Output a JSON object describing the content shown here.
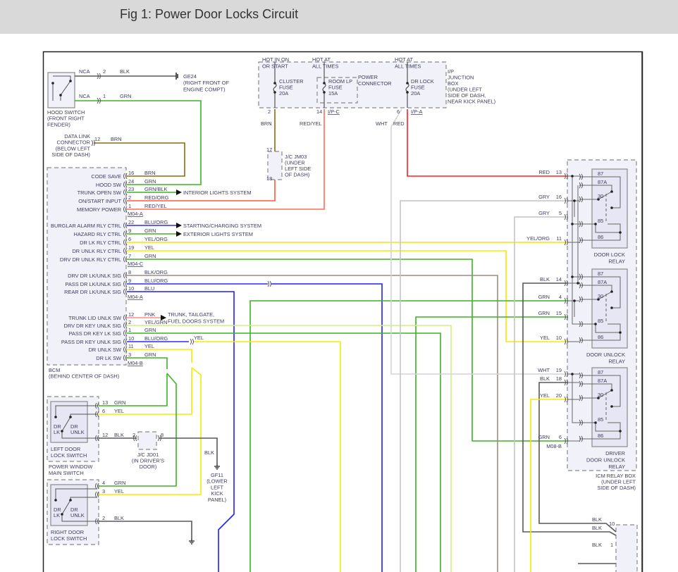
{
  "title": "Fig 1: Power Door Locks Circuit",
  "wire_colors": {
    "BLK": "#585858",
    "GRN": "#3cb424",
    "BRN": "#8a6a10",
    "RED": "#ff2020",
    "RED/ORG": "#ff5a38",
    "RED/YEL": "#ff6b55",
    "YEL": "#f5ea00",
    "YEL/ORG": "#f5e400",
    "BLU": "#1f1fff",
    "BLU/ORG": "#2a2aff",
    "GRY": "#c4c4c4",
    "WHT": "#d4d4d4",
    "PNK": "#ff8c8c",
    "YEL/GRN": "#d2ee80",
    "GRN/BLK": "#3cb424",
    "BLK/ORG": "#9c8c84"
  },
  "hood_switch": {
    "label": [
      "HOOD SWITCH",
      "(FRONT RIGHT",
      "FENDER)"
    ],
    "conn_a": "NCA",
    "pin_a": "2",
    "wire_a": "BLK",
    "conn_b": "NCA",
    "pin_b": "1",
    "wire_b": "GRN",
    "ground": "GE24",
    "ground_desc": [
      "(RIGHT FRONT OF",
      "ENGINE COMPT)"
    ]
  },
  "data_link": {
    "label": [
      "DATA LINK",
      "CONNECTOR",
      "(BELOW LEFT",
      "SIDE OF DASH)"
    ],
    "pin": "12",
    "wire": "BRN"
  },
  "junction_box": {
    "hot1": [
      "HOT IN ON",
      "OR START"
    ],
    "hot2": [
      "HOT AT",
      "ALL TIMES"
    ],
    "hot3": [
      "HOT AT",
      "ALL TIMES"
    ],
    "fuse1": [
      "CLUSTER",
      "FUSE",
      "20A"
    ],
    "fuse2": [
      "ROOM LP",
      "FUSE",
      "15A"
    ],
    "fuse3": [
      "DR LOCK",
      "FUSE",
      "20A"
    ],
    "power_connector": [
      "POWER",
      "CONNECTOR"
    ],
    "label": [
      "I/P",
      "JUNCTION",
      "BOX",
      "(UNDER LEFT",
      "SIDE OF DASH,",
      "NEAR KICK PANEL)"
    ],
    "pin1": "2",
    "pin2": "14",
    "conn2": "I/P-C",
    "pin3": "6",
    "conn3": "I/P-A",
    "wire1": "BRN",
    "wire2": "RED/YEL",
    "wire3a": "WHT",
    "wire3b": "RED"
  },
  "jc_jm03": {
    "pin_in": "17",
    "pin_out": "18",
    "label": [
      "J/C JM03",
      "(UNDER",
      "LEFT SIDE",
      "OF DASH)"
    ]
  },
  "bcm": {
    "label": [
      "BCM",
      "(BEHIND CENTER OF DASH)"
    ],
    "pins": [
      {
        "label": "CODE SAVE",
        "pin": "16",
        "wire": "BRN"
      },
      {
        "label": "HOOD SW",
        "pin": "24",
        "wire": "GRN"
      },
      {
        "label": "TRUNK OPEN SW",
        "pin": "23",
        "wire": "GRN/BLK"
      },
      {
        "label": "ON/START INPUT",
        "pin": "2",
        "wire": "RED/ORG"
      },
      {
        "label": "MEMORY POWER",
        "pin": "1",
        "wire": "RED/YEL"
      },
      {
        "label": "BURGLAR ALARM RLY CTRL",
        "pin": "22",
        "wire": "BLU/ORG"
      },
      {
        "label": "HAZARD RLY CTRL",
        "pin": "9",
        "wire": "GRN"
      },
      {
        "label": "DR LK RLY CTRL",
        "pin": "6",
        "wire": "YEL/ORG"
      },
      {
        "label": "DR UNLK RLY CTRL",
        "pin": "19",
        "wire": "YEL"
      },
      {
        "label": "DRV DR UNLK RLY CTRL",
        "pin": "7",
        "wire": "GRN"
      },
      {
        "label": "DRV DR LK/UNLK SIG",
        "pin": "8",
        "wire": "BLK/ORG"
      },
      {
        "label": "PASS DR LK/UNLK SIG",
        "pin": "9",
        "wire": "BLU/ORG"
      },
      {
        "label": "REAR DR LK/UNLK SIG",
        "pin": "10",
        "wire": "BLU"
      },
      {
        "label": "TRUNK LID UNLK SW",
        "pin": "12",
        "wire": "PNK"
      },
      {
        "label": "DRV DR KEY UNLK SIG",
        "pin": "2",
        "wire": "YEL/GRN"
      },
      {
        "label": "PASS DR KEY LK SIG",
        "pin": "1",
        "wire": "GRN"
      },
      {
        "label": "PASS DR KEY UNLK SIG",
        "pin": "10",
        "wire": "BLU/ORG"
      },
      {
        "label": "DR UNLK SW",
        "pin": "11",
        "wire": "YEL"
      },
      {
        "label": "DR LK SW",
        "pin": "3",
        "wire": "GRN"
      }
    ],
    "connectors": [
      "M04-A",
      "M04-C",
      "M04-A",
      "M04-B"
    ]
  },
  "systems": {
    "interior": "INTERIOR LIGHTS SYSTEM",
    "starting": "STARTING/CHARGING SYSTEM",
    "exterior": "EXTERIOR LIGHTS SYSTEM",
    "trunk": [
      "TRUNK, TAILGATE,",
      "FUEL DOORS SYSTEM"
    ]
  },
  "pass_key_unlk_out_wire": "YEL",
  "icm_relay_box": {
    "label": [
      "ICM RELAY BOX",
      "(UNDER LEFT",
      "SIDE OF DASH)"
    ],
    "pins": [
      {
        "wire": "RED",
        "pin": "13"
      },
      {
        "wire": "GRY",
        "pin": "16"
      },
      {
        "wire": "GRY",
        "pin": "5"
      },
      {
        "wire": "YEL/ORG",
        "pin": "11"
      },
      {
        "wire": "BLK",
        "pin": "14"
      },
      {
        "wire": "GRN",
        "pin": "4"
      },
      {
        "wire": "GRN",
        "pin": "15"
      },
      {
        "wire": "YEL",
        "pin": "10"
      },
      {
        "wire": "WHT",
        "pin": "19"
      },
      {
        "wire": "BLK",
        "pin": "18"
      },
      {
        "wire": "YEL",
        "pin": "20"
      },
      {
        "wire": "GRN",
        "pin": "6"
      }
    ],
    "connector": "M08-B",
    "relay_terminals": [
      "87",
      "87A",
      "30",
      "85",
      "86"
    ],
    "relays": [
      {
        "label": [
          "DOOR LOCK",
          "RELAY"
        ]
      },
      {
        "label": [
          "DOOR UNLOCK",
          "RELAY"
        ]
      },
      {
        "label": [
          "DRIVER",
          "DOOR UNLOCK",
          "RELAY"
        ]
      }
    ]
  },
  "left_switch": {
    "pins": [
      {
        "pin": "13",
        "wire": "GRN"
      },
      {
        "pin": "6",
        "wire": "YEL"
      },
      {
        "pin": "12",
        "wire": "BLK"
      }
    ],
    "lk": [
      "DR",
      "LK"
    ],
    "unlk": [
      "DR",
      "UNLK"
    ],
    "label": [
      "LEFT DOOR",
      "LOCK SWITCH"
    ],
    "parent": [
      "POWER WINDOW",
      "MAIN SWITCH"
    ]
  },
  "jc_jd01": {
    "pin_in": "2",
    "pin_out": "8",
    "label": [
      "J/C JD01",
      "(IN DRIVER'S",
      "DOOR)"
    ]
  },
  "ground_gf11": {
    "wire": "BLK",
    "label": [
      "GF11",
      "(LOWER",
      "LEFT",
      "KICK",
      "PANEL)"
    ]
  },
  "right_switch": {
    "pins": [
      {
        "pin": "4",
        "wire": "GRN"
      },
      {
        "pin": "3",
        "wire": "YEL"
      },
      {
        "pin": "2",
        "wire": "BLK"
      }
    ],
    "lk": [
      "DR",
      "LK"
    ],
    "unlk": [
      "DR",
      "UNLK"
    ],
    "label": [
      "RIGHT DOOR",
      "LOCK SWITCH"
    ]
  },
  "bottom_conn": {
    "wires": [
      "BLK",
      "BLK",
      "BLK"
    ],
    "pins": [
      "10",
      "1"
    ]
  }
}
